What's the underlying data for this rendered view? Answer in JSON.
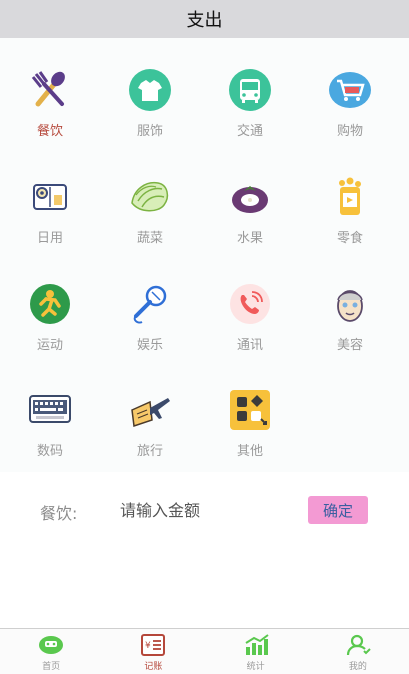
{
  "header": {
    "title": "支出"
  },
  "categories": [
    {
      "label": "餐饮",
      "icon": "fork-spoon-icon",
      "active": true
    },
    {
      "label": "服饰",
      "icon": "tshirt-icon"
    },
    {
      "label": "交通",
      "icon": "bus-icon"
    },
    {
      "label": "购物",
      "icon": "shopping-cart-icon"
    },
    {
      "label": "日用",
      "icon": "tissue-roll-icon"
    },
    {
      "label": "蔬菜",
      "icon": "cabbage-icon"
    },
    {
      "label": "水果",
      "icon": "mangosteen-icon"
    },
    {
      "label": "零食",
      "icon": "snack-can-icon"
    },
    {
      "label": "运动",
      "icon": "running-person-icon"
    },
    {
      "label": "娱乐",
      "icon": "microphone-icon"
    },
    {
      "label": "通讯",
      "icon": "phone-call-icon"
    },
    {
      "label": "美容",
      "icon": "face-mask-icon"
    },
    {
      "label": "数码",
      "icon": "keyboard-icon"
    },
    {
      "label": "旅行",
      "icon": "plane-ticket-icon"
    },
    {
      "label": "其他",
      "icon": "other-apps-icon"
    }
  ],
  "entry": {
    "category_label": "餐饮:",
    "amount_placeholder": "请输入金额",
    "confirm_label": "确定"
  },
  "bottom_nav": [
    {
      "label": "首页",
      "icon": "home-icon"
    },
    {
      "label": "记账",
      "icon": "ledger-icon",
      "active": true
    },
    {
      "label": "统计",
      "icon": "bar-chart-icon"
    },
    {
      "label": "我的",
      "icon": "profile-icon"
    }
  ],
  "colors": {
    "title_bar": "#d9d9dc",
    "active_label": "#b5473a",
    "confirm_button": "#f39ad3",
    "nav_green": "#5ac84e"
  }
}
